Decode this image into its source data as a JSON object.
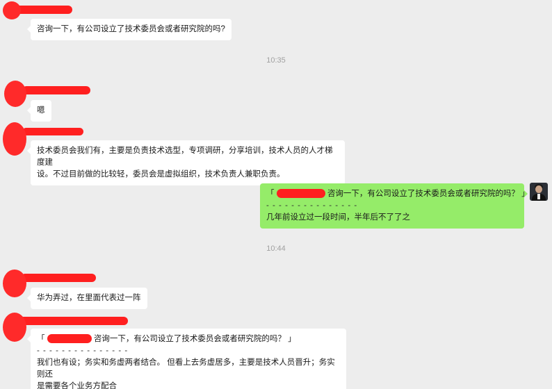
{
  "messages": {
    "m1": {
      "text": "咨询一下，有公司设立了技术委员会或者研究院的吗?"
    },
    "time1": "10:35",
    "m2": {
      "text": "嗯"
    },
    "m3": {
      "line1": "技术委员会我们有，主要是负责技术选型，专项调研，分享培训，技术人员的人才梯度建",
      "line2": "设。不过目前做的比较轻，委员会是虚拟组织，技术负责人兼职负责。"
    },
    "m4": {
      "quote_open": "「",
      "quote_text": "咨询一下，有公司设立了技术委员会或者研究院的吗？",
      "quote_close": "」",
      "dashes": "- - - - - - - - - - - - - - -",
      "reply": "几年前设立过一段时间，半年后不了了之"
    },
    "time2": "10:44",
    "m5": {
      "text": "华为弄过，在里面代表过一阵"
    },
    "m6": {
      "quote_open": "「",
      "quote_text": "咨询一下，有公司设立了技术委员会或者研究院的吗？",
      "quote_close": "」",
      "dashes": "- - - - - - - - - - - - - - -",
      "line1": "我们也有设；务实和务虚两者结合。 但看上去务虚居多，主要是技术人员晋升；务实则还",
      "line2": "是需要各个业务方配合"
    }
  },
  "colors": {
    "background": "#ededed",
    "self_bubble": "#95ec69",
    "other_bubble": "#ffffff",
    "redaction": "#ff1f1f"
  }
}
